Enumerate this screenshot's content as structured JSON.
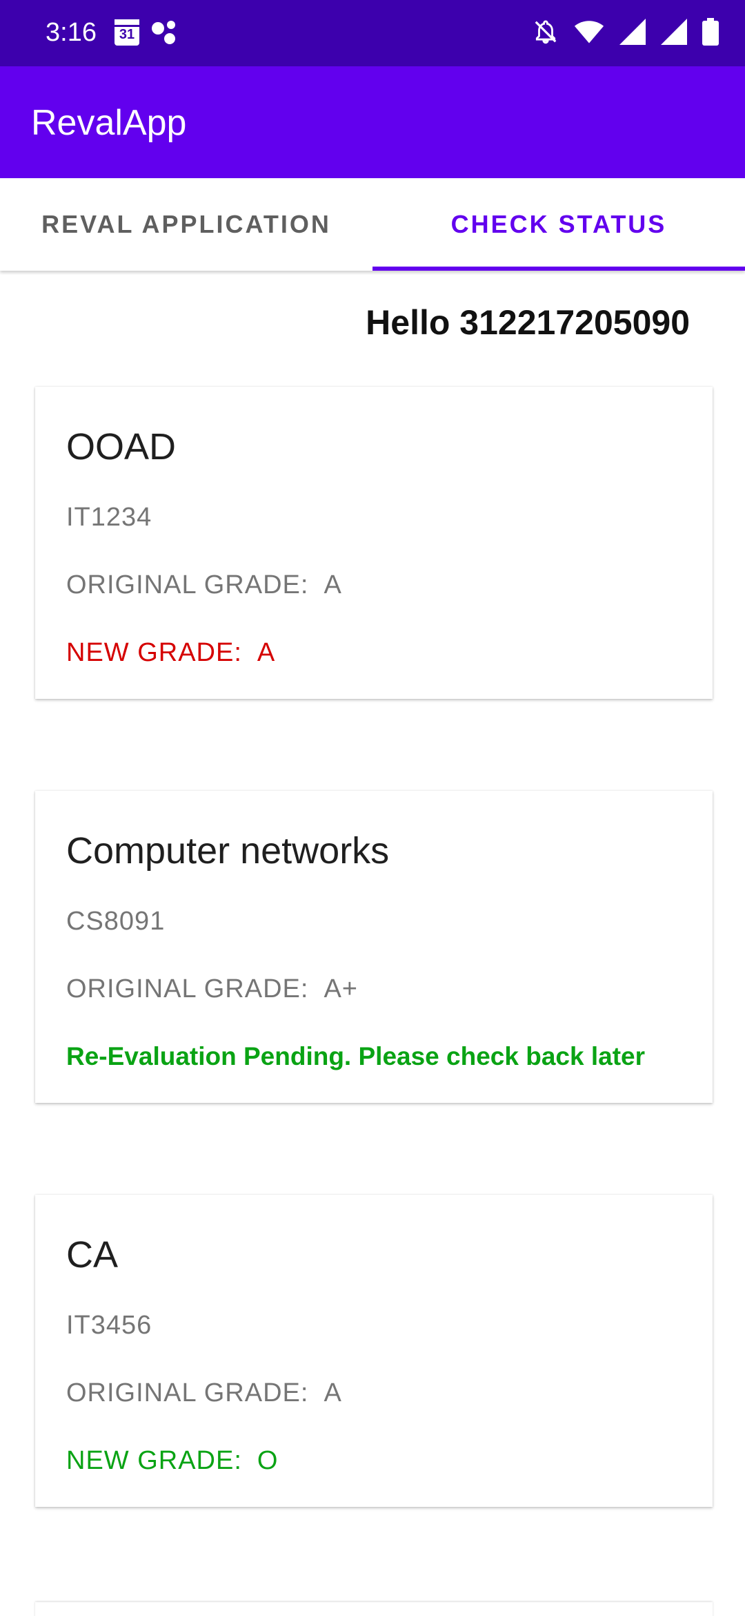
{
  "status_bar": {
    "time": "3:16",
    "calendar_day": "31",
    "icons": [
      "calendar-icon",
      "assistant-icon",
      "mute-icon",
      "wifi-icon",
      "signal-icon",
      "signal-icon",
      "battery-icon"
    ]
  },
  "app_bar": {
    "title": "RevalApp"
  },
  "tabs": [
    {
      "label": "REVAL APPLICATION",
      "selected": false
    },
    {
      "label": "CHECK STATUS",
      "selected": true
    }
  ],
  "greeting": "Hello 312217205090",
  "courses": [
    {
      "name": "OOAD",
      "code": "IT1234",
      "original_label": "ORIGINAL GRADE:",
      "original_grade": "A",
      "result_label": "NEW GRADE:",
      "result_value": "A",
      "result_color": "#d50000"
    },
    {
      "name": "Computer networks",
      "code": "CS8091",
      "original_label": "ORIGINAL GRADE:",
      "original_grade": "A+",
      "result_label": "Re-Evaluation Pending. Please check back later",
      "result_value": "",
      "result_color": "#0aa314"
    },
    {
      "name": "CA",
      "code": "IT3456",
      "original_label": "ORIGINAL GRADE:",
      "original_grade": "A",
      "result_label": "NEW GRADE:",
      "result_value": "O",
      "result_color": "#0aa314"
    }
  ],
  "colors": {
    "status_bar": "#3d00ad",
    "primary": "#6200ee",
    "red": "#d50000",
    "green": "#0aa314"
  }
}
